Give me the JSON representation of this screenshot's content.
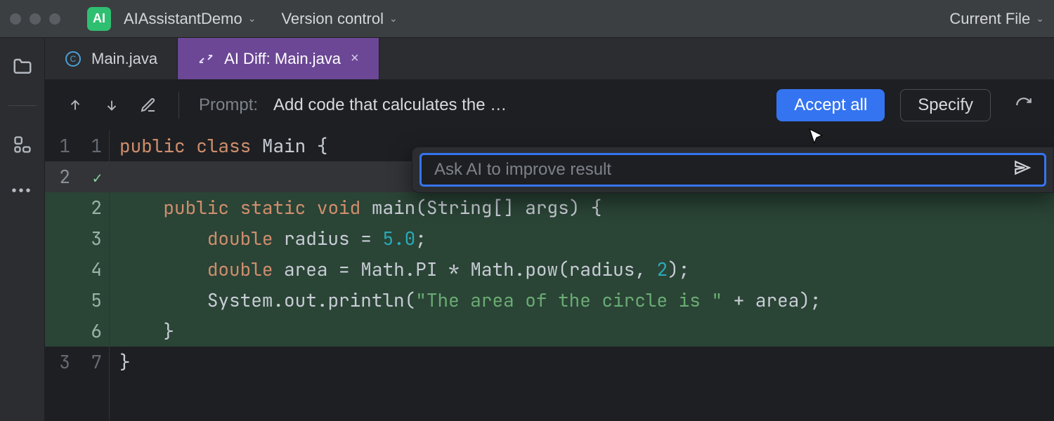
{
  "titlebar": {
    "app_badge": "AI",
    "project_name": "AIAssistantDemo",
    "vcs_label": "Version control",
    "right_label": "Current File"
  },
  "tabs": [
    {
      "icon": "class-circle",
      "label": "Main.java",
      "active": false,
      "closeable": false
    },
    {
      "icon": "ai-diff",
      "label": "AI Diff: Main.java",
      "active": true,
      "closeable": true
    }
  ],
  "diffbar": {
    "prompt_label": "Prompt:",
    "prompt_text": "Add code that calculates the …",
    "accept_label": "Accept all",
    "specify_label": "Specify"
  },
  "ask_popup": {
    "placeholder": "Ask AI to improve result"
  },
  "code": {
    "lines": [
      {
        "a": "1",
        "b": "1",
        "kind": "ctx",
        "tokens": [
          [
            "kw",
            "public"
          ],
          [
            "sp",
            " "
          ],
          [
            "kw",
            "class"
          ],
          [
            "sp",
            " "
          ],
          [
            "id",
            "Main"
          ],
          [
            "sp",
            " "
          ],
          [
            "pn",
            "{"
          ]
        ]
      },
      {
        "a": "2",
        "b": "",
        "kind": "hl",
        "tokens": [],
        "check": true
      },
      {
        "a": "",
        "b": "2",
        "kind": "add",
        "tokens": [
          [
            "sp",
            "    "
          ],
          [
            "kw",
            "public"
          ],
          [
            "sp",
            " "
          ],
          [
            "kw",
            "static"
          ],
          [
            "sp",
            " "
          ],
          [
            "kw",
            "void"
          ],
          [
            "sp",
            " "
          ],
          [
            "fn",
            "main"
          ],
          [
            "pn",
            "("
          ],
          [
            "id",
            "String"
          ],
          [
            "pn",
            "[]"
          ],
          [
            "sp",
            " "
          ],
          [
            "id",
            "args"
          ],
          [
            "pn",
            ")"
          ],
          [
            "sp",
            " "
          ],
          [
            "pn",
            "{"
          ]
        ]
      },
      {
        "a": "",
        "b": "3",
        "kind": "add",
        "tokens": [
          [
            "sp",
            "        "
          ],
          [
            "kw",
            "double"
          ],
          [
            "sp",
            " "
          ],
          [
            "id",
            "radius"
          ],
          [
            "sp",
            " "
          ],
          [
            "pn",
            "="
          ],
          [
            "sp",
            " "
          ],
          [
            "num",
            "5.0"
          ],
          [
            "pn",
            ";"
          ]
        ]
      },
      {
        "a": "",
        "b": "4",
        "kind": "add",
        "tokens": [
          [
            "sp",
            "        "
          ],
          [
            "kw",
            "double"
          ],
          [
            "sp",
            " "
          ],
          [
            "id",
            "area"
          ],
          [
            "sp",
            " "
          ],
          [
            "pn",
            "="
          ],
          [
            "sp",
            " "
          ],
          [
            "id",
            "Math"
          ],
          [
            "pn",
            "."
          ],
          [
            "id",
            "PI"
          ],
          [
            "sp",
            " "
          ],
          [
            "pn",
            "*"
          ],
          [
            "sp",
            " "
          ],
          [
            "id",
            "Math"
          ],
          [
            "pn",
            "."
          ],
          [
            "fn",
            "pow"
          ],
          [
            "pn",
            "("
          ],
          [
            "id",
            "radius"
          ],
          [
            "pn",
            ","
          ],
          [
            "sp",
            " "
          ],
          [
            "num",
            "2"
          ],
          [
            "pn",
            ")"
          ],
          [
            "pn",
            ";"
          ]
        ]
      },
      {
        "a": "",
        "b": "5",
        "kind": "add",
        "tokens": [
          [
            "sp",
            "        "
          ],
          [
            "id",
            "System"
          ],
          [
            "pn",
            "."
          ],
          [
            "id",
            "out"
          ],
          [
            "pn",
            "."
          ],
          [
            "fn",
            "println"
          ],
          [
            "pn",
            "("
          ],
          [
            "str",
            "\"The area of the circle is \""
          ],
          [
            "sp",
            " "
          ],
          [
            "pn",
            "+"
          ],
          [
            "sp",
            " "
          ],
          [
            "id",
            "area"
          ],
          [
            "pn",
            ")"
          ],
          [
            "pn",
            ";"
          ]
        ]
      },
      {
        "a": "",
        "b": "6",
        "kind": "add",
        "tokens": [
          [
            "sp",
            "    "
          ],
          [
            "pn",
            "}"
          ]
        ]
      },
      {
        "a": "3",
        "b": "7",
        "kind": "ctx",
        "tokens": [
          [
            "pn",
            "}"
          ]
        ]
      }
    ]
  }
}
